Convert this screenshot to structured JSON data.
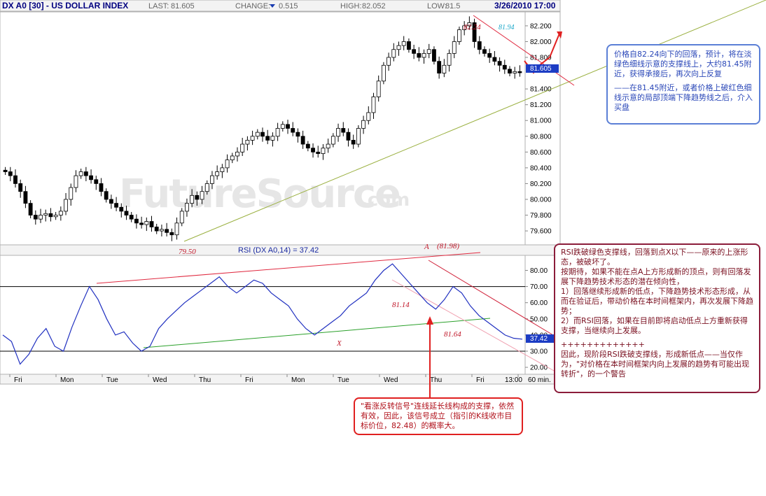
{
  "header": {
    "title": "DX A0 [30] - US DOLLAR INDEX",
    "last_label": "LAST:",
    "last_value": "81.605",
    "change_label": "CHANGE:",
    "change_value": "0.515",
    "high_label": "HIGH:",
    "high_value": "82.052",
    "low_label": "LOW:",
    "low_value": "81.5",
    "date": "3/26/2010 17:00"
  },
  "watermark": {
    "text": "FutureSource",
    "suffix": ".com"
  },
  "chart_data": [
    {
      "type": "candlestick",
      "title": "DX A0 [30] - US DOLLAR INDEX",
      "ylim": [
        79.45,
        82.35
      ],
      "yticks": [
        "82.200",
        "82.000",
        "81.800",
        "81.400",
        "81.200",
        "81.000",
        "80.800",
        "80.600",
        "80.400",
        "80.200",
        "80.000",
        "79.800",
        "79.600"
      ],
      "last_price_label": "81.605",
      "grid": false,
      "series": [
        {
          "values": [
            80.35,
            80.3,
            80.2,
            80.1,
            79.95,
            79.8,
            79.75,
            79.8,
            79.82,
            79.78,
            79.8,
            79.85,
            80.0,
            80.15,
            80.3,
            80.35,
            80.3,
            80.25,
            80.2,
            80.1,
            80.0,
            79.95,
            79.9,
            79.85,
            79.8,
            79.75,
            79.7,
            79.68,
            79.72,
            79.65,
            79.6,
            79.62,
            79.58,
            79.55,
            79.7,
            79.85,
            79.95,
            80.05,
            80.0,
            80.1,
            80.2,
            80.3,
            80.35,
            80.4,
            80.5,
            80.55,
            80.6,
            80.7,
            80.75,
            80.8,
            80.85,
            80.8,
            80.75,
            80.8,
            80.9,
            80.95,
            80.9,
            80.85,
            80.8,
            80.7,
            80.65,
            80.6,
            80.58,
            80.65,
            80.7,
            80.8,
            80.9,
            80.85,
            80.75,
            80.7,
            80.9,
            81.0,
            81.1,
            81.3,
            81.5,
            81.7,
            81.8,
            81.9,
            81.95,
            82.0,
            81.9,
            81.85,
            81.8,
            81.85,
            81.9,
            81.75,
            81.6,
            81.7,
            81.85,
            82.0,
            82.15,
            82.2,
            82.24,
            82.0,
            81.9,
            81.85,
            81.8,
            81.75,
            81.7,
            81.65,
            81.6,
            81.62,
            81.605
          ]
        }
      ],
      "annotations": [
        "82.24",
        "81.94",
        "79.50"
      ]
    },
    {
      "type": "line",
      "title": "RSI (DX A0,14) = 37.42",
      "ylim": [
        17,
        88
      ],
      "yticks": [
        "80.00",
        "70.00",
        "60.00",
        "50.00",
        "40.00",
        "30.00",
        "20.00"
      ],
      "reference_lines": [
        70,
        30
      ],
      "last_value_label": "37.42",
      "x_categories": [
        "Fri",
        "Mon",
        "Tue",
        "Wed",
        "Thu",
        "Fri",
        "Mon",
        "Tue",
        "Wed",
        "Thu",
        "Fri",
        "13:00"
      ],
      "x_unit": "60 min.",
      "series": [
        {
          "values": [
            40,
            36,
            22,
            28,
            38,
            44,
            33,
            30,
            45,
            58,
            70,
            62,
            50,
            40,
            42,
            35,
            30,
            33,
            44,
            50,
            55,
            60,
            64,
            68,
            72,
            76,
            70,
            66,
            70,
            74,
            72,
            66,
            62,
            58,
            50,
            44,
            40,
            44,
            48,
            52,
            58,
            62,
            66,
            74,
            80,
            84,
            78,
            72,
            66,
            60,
            56,
            62,
            70,
            66,
            58,
            52,
            48,
            44,
            40,
            38,
            37.42
          ]
        }
      ],
      "annotations": [
        "A",
        "(81.98)",
        "81.14",
        "81.64",
        "X"
      ]
    }
  ],
  "notes": {
    "blue": [
      "价格自82.24向下的回落，预计，将在淡绿色细线示意的支撑线上，大约81.45附近，获得承接后，再次向上反复",
      "——在81.45附近，或者价格上破红色细线示意的局部顶端下降趋势线之后，介入买盘"
    ],
    "darkred": [
      "RSI跌破绿色支撑线，回落到点X以下——原来的上涨形态，被破坏了。",
      "按期待，如果不能在点A上方形成新的顶点，则有回落发展下降趋势技术形态的潜在倾向性，",
      "1）回落继续形成新的低点，下降趋势技术形态形成，从而在验证后，带动价格在本时间框架内，再次发展下降趋势；",
      "2）而RSI回落，如果在目前即将启动低点上方重新获得支撑，当继续向上发展。",
      "+++++++++++++",
      "因此，现阶段RSI跌破支撑线，形成新低点——当仅作为，\"对价格在本时间框架内向上发展的趋势有可能出现转折\"，的一个警告"
    ],
    "red": [
      "\"看涨反转信号\"连线延长线构成的支撑，依然有效，因此，该信号成立（指引的K线收市目标价位，82.48）的概率大。"
    ]
  }
}
